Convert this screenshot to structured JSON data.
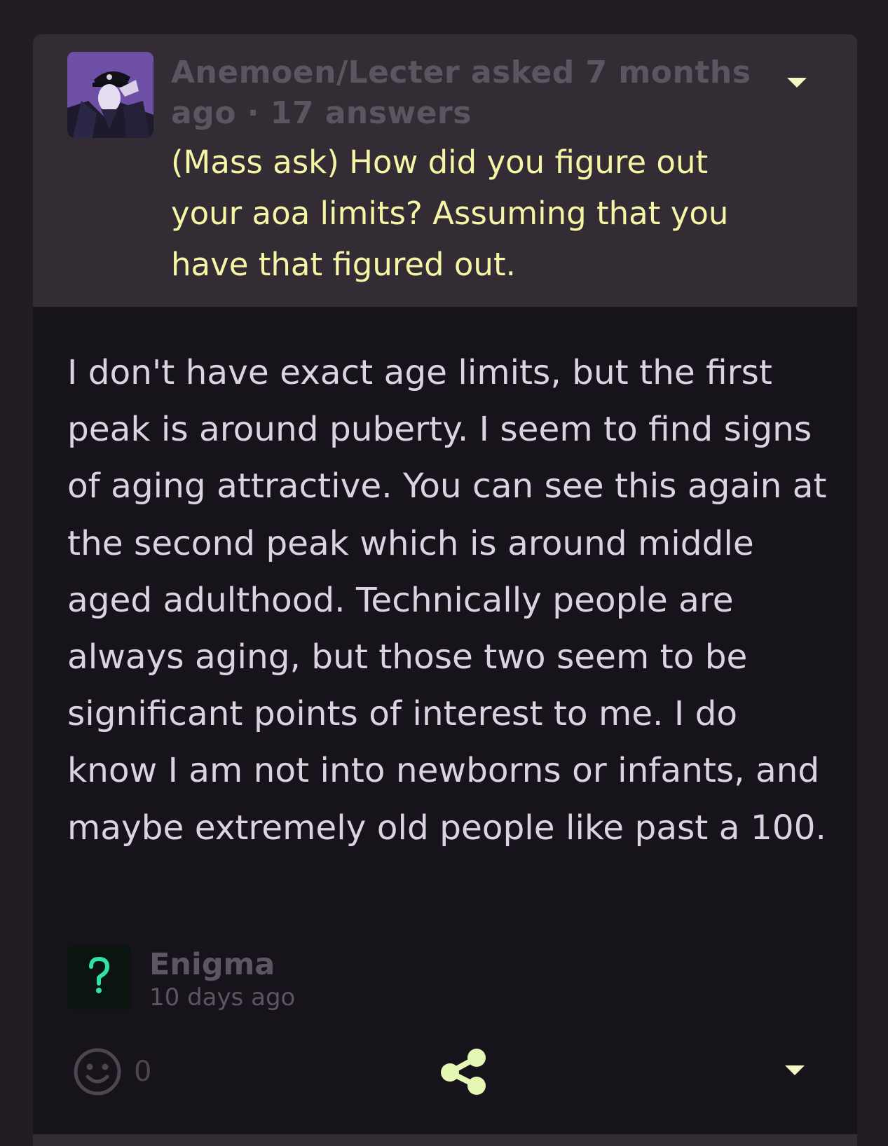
{
  "question": {
    "asker": "Anemoen/Lecter",
    "meta_line_1": "Anemoen/Lecter asked 7 months",
    "meta_line_2": "ago · 17 answers",
    "text": "(Mass ask) How did you figure out your aoa limits? Assuming that you have that figured out.",
    "menu_icon": "chevron-down-icon"
  },
  "answer": {
    "text": "I don't have exact age limits, but the first peak is around puberty. I seem to find signs of aging attractive. You can see this again at the second peak which is around middle aged adulthood. Technically people are always aging, but those two seem to be significant points of interest to me. I do know I am not into newborns or infants, and maybe extremely old people like past a 100.",
    "author": "Enigma",
    "time": "10 days ago",
    "reaction_count": "0",
    "reaction_icon": "smiley-face-icon",
    "share_icon": "share-icon",
    "menu_icon": "chevron-down-icon"
  },
  "colors": {
    "page_bg": "#211d23",
    "question_bg": "#342c35",
    "answer_bg": "#16131a",
    "question_text": "#f3f7a5",
    "answer_text": "#dcd2e2",
    "muted_text": "#5d5562",
    "accent": "#e5f7b5"
  }
}
